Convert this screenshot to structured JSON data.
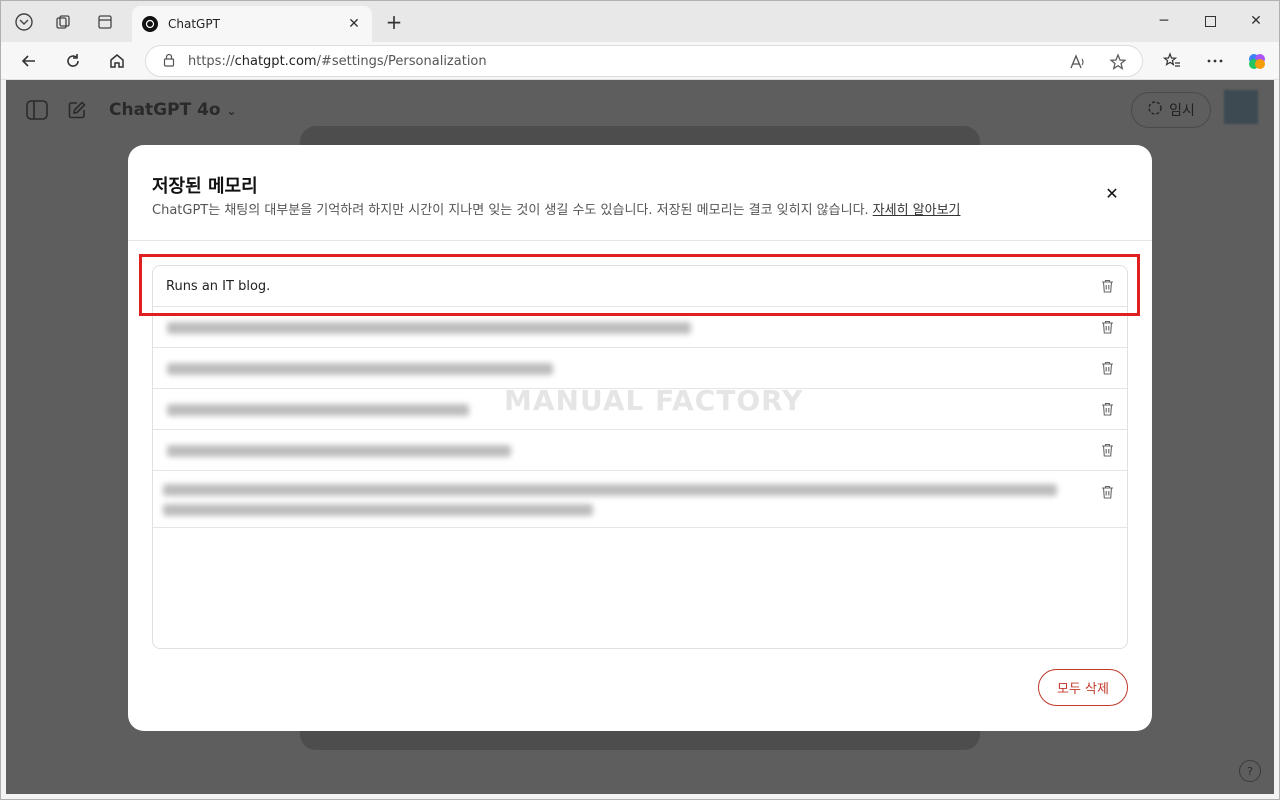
{
  "browser": {
    "tab_title": "ChatGPT",
    "url_prefix": "https://",
    "url_host": "chatgpt.com",
    "url_path": "/#settings/Personalization"
  },
  "app": {
    "model_title": "ChatGPT 4o",
    "temporary_label": "임시",
    "help_label": "?"
  },
  "modal": {
    "title": "저장된 메모리",
    "description": "ChatGPT는 채팅의 대부분을 기억하려 하지만 시간이 지나면 잊는 것이 생길 수도 있습니다. 저장된 메모리는 결코 잊히지 않습니다.",
    "learn_more": "자세히 알아보기",
    "memories": [
      "Runs an IT blog."
    ],
    "delete_all": "모두 삭제"
  },
  "watermark": "MANUAL FACTORY",
  "colors": {
    "highlight": "#e02020",
    "danger": "#c0392b"
  }
}
